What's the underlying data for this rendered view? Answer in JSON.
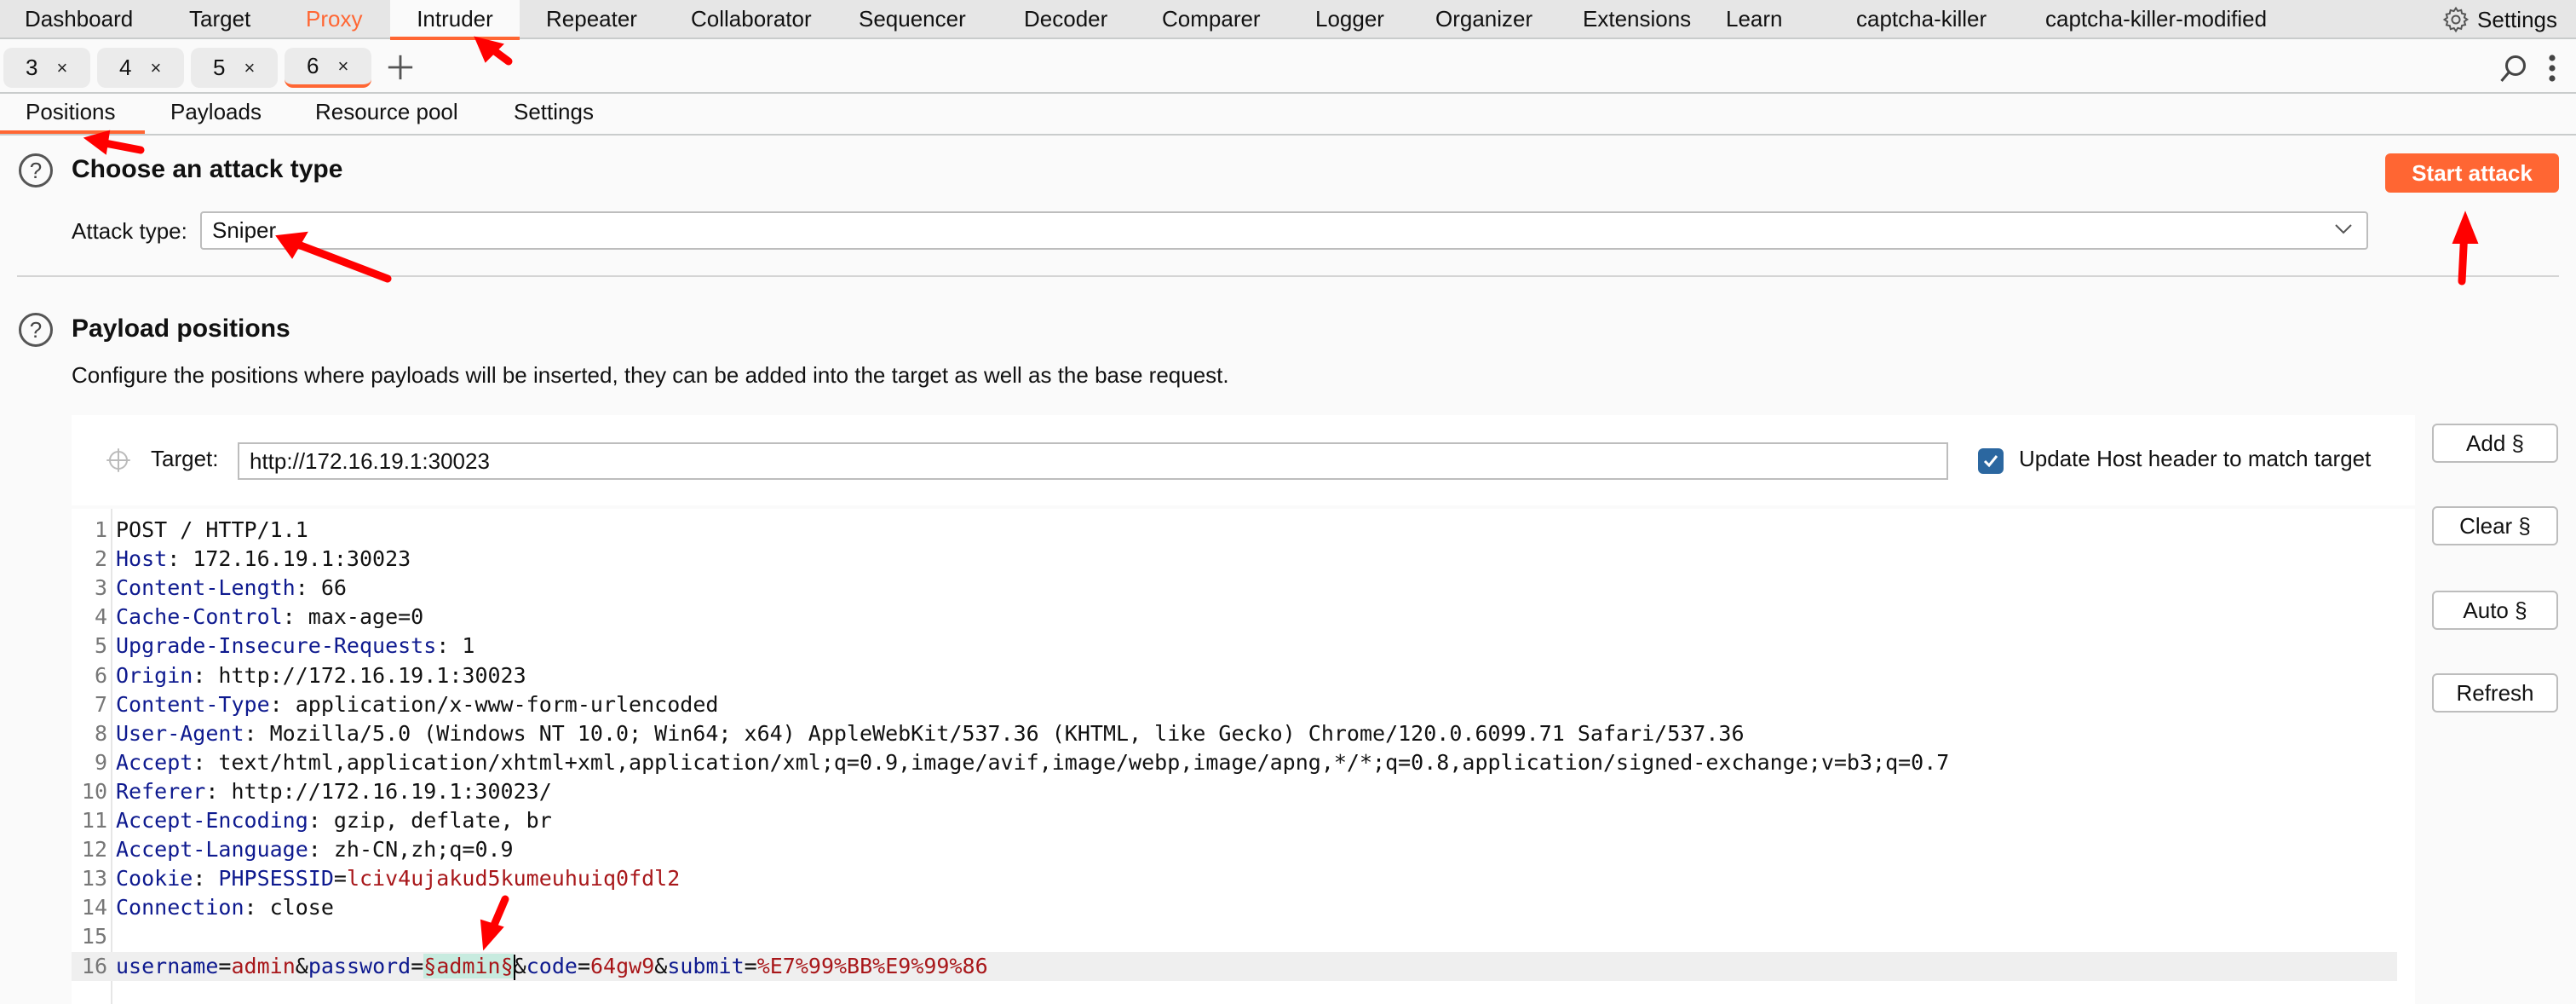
{
  "topnav": {
    "items": [
      {
        "label": "Dashboard"
      },
      {
        "label": "Target"
      },
      {
        "label": "Proxy"
      },
      {
        "label": "Intruder",
        "active": true
      },
      {
        "label": "Repeater"
      },
      {
        "label": "Collaborator"
      },
      {
        "label": "Sequencer"
      },
      {
        "label": "Decoder"
      },
      {
        "label": "Comparer"
      },
      {
        "label": "Logger"
      },
      {
        "label": "Organizer"
      },
      {
        "label": "Extensions"
      },
      {
        "label": "Learn"
      },
      {
        "label": "captcha-killer"
      },
      {
        "label": "captcha-killer-modified"
      }
    ],
    "settings_label": "Settings",
    "accent": "#ff6633"
  },
  "attack_tabs": {
    "tabs": [
      {
        "label": "3",
        "close": "×"
      },
      {
        "label": "4",
        "close": "×"
      },
      {
        "label": "5",
        "close": "×"
      },
      {
        "label": "6",
        "close": "×",
        "active": true
      }
    ],
    "add_icon": "+"
  },
  "subtabs": {
    "items": [
      {
        "label": "Positions",
        "active": true
      },
      {
        "label": "Payloads"
      },
      {
        "label": "Resource pool"
      },
      {
        "label": "Settings"
      }
    ]
  },
  "attack_section": {
    "help_icon": "?",
    "title": "Choose an attack type",
    "attack_type_label": "Attack type:",
    "attack_type_value": "Sniper",
    "start_button": "Start attack"
  },
  "positions_section": {
    "help_icon": "?",
    "title": "Payload positions",
    "description": "Configure the positions where payloads will be inserted, they can be added into the target as well as the base request.",
    "target_label": "Target:",
    "target_value": "http://172.16.19.1:30023",
    "update_host_label": "Update Host header to match target",
    "update_host_checked": true,
    "buttons": {
      "add": "Add §",
      "clear": "Clear §",
      "auto": "Auto §",
      "refresh": "Refresh"
    }
  },
  "request": {
    "lines": [
      {
        "n": "1",
        "segments": [
          {
            "t": "POST / HTTP/1.1",
            "c": "v"
          }
        ]
      },
      {
        "n": "2",
        "segments": [
          {
            "t": "Host",
            "c": "k"
          },
          {
            "t": ": 172.16.19.1:30023",
            "c": "v"
          }
        ]
      },
      {
        "n": "3",
        "segments": [
          {
            "t": "Content-Length",
            "c": "k"
          },
          {
            "t": ": 66",
            "c": "v"
          }
        ]
      },
      {
        "n": "4",
        "segments": [
          {
            "t": "Cache-Control",
            "c": "k"
          },
          {
            "t": ": max-age=0",
            "c": "v"
          }
        ]
      },
      {
        "n": "5",
        "segments": [
          {
            "t": "Upgrade-Insecure-Requests",
            "c": "k"
          },
          {
            "t": ": 1",
            "c": "v"
          }
        ]
      },
      {
        "n": "6",
        "segments": [
          {
            "t": "Origin",
            "c": "k"
          },
          {
            "t": ": http://172.16.19.1:30023",
            "c": "v"
          }
        ]
      },
      {
        "n": "7",
        "segments": [
          {
            "t": "Content-Type",
            "c": "k"
          },
          {
            "t": ": application/x-www-form-urlencoded",
            "c": "v"
          }
        ]
      },
      {
        "n": "8",
        "segments": [
          {
            "t": "User-Agent",
            "c": "k"
          },
          {
            "t": ": Mozilla/5.0 (Windows NT 10.0; Win64; x64) AppleWebKit/537.36 (KHTML, like Gecko) Chrome/120.0.6099.71 Safari/537.36",
            "c": "v"
          }
        ]
      },
      {
        "n": "9",
        "segments": [
          {
            "t": "Accept",
            "c": "k"
          },
          {
            "t": ": text/html,application/xhtml+xml,application/xml;q=0.9,image/avif,image/webp,image/apng,*/*;q=0.8,application/signed-exchange;v=b3;q=0.7",
            "c": "v"
          }
        ]
      },
      {
        "n": "10",
        "segments": [
          {
            "t": "Referer",
            "c": "k"
          },
          {
            "t": ": http://172.16.19.1:30023/",
            "c": "v"
          }
        ]
      },
      {
        "n": "11",
        "segments": [
          {
            "t": "Accept-Encoding",
            "c": "k"
          },
          {
            "t": ": gzip, deflate, br",
            "c": "v"
          }
        ]
      },
      {
        "n": "12",
        "segments": [
          {
            "t": "Accept-Language",
            "c": "k"
          },
          {
            "t": ": zh-CN,zh;q=0.9",
            "c": "v"
          }
        ]
      },
      {
        "n": "13",
        "segments": [
          {
            "t": "Cookie",
            "c": "k"
          },
          {
            "t": ": ",
            "c": "v"
          },
          {
            "t": "PHPSESSID",
            "c": "k"
          },
          {
            "t": "=",
            "c": "v"
          },
          {
            "t": "lciv4ujakud5kumeuhuiq0fdl2",
            "c": "r"
          }
        ]
      },
      {
        "n": "14",
        "segments": [
          {
            "t": "Connection",
            "c": "k"
          },
          {
            "t": ": close",
            "c": "v"
          }
        ]
      },
      {
        "n": "15",
        "segments": []
      },
      {
        "n": "16",
        "current": true,
        "segments": [
          {
            "t": "username",
            "c": "k"
          },
          {
            "t": "=",
            "c": "v"
          },
          {
            "t": "admin",
            "c": "r"
          },
          {
            "t": "&",
            "c": "v"
          },
          {
            "t": "password",
            "c": "k"
          },
          {
            "t": "=",
            "c": "v"
          },
          {
            "t": "§admin§",
            "c": "r marker"
          },
          {
            "caret": true
          },
          {
            "t": "&",
            "c": "v"
          },
          {
            "t": "code",
            "c": "k"
          },
          {
            "t": "=",
            "c": "v"
          },
          {
            "t": "64gw9",
            "c": "r"
          },
          {
            "t": "&",
            "c": "v"
          },
          {
            "t": "submit",
            "c": "k"
          },
          {
            "t": "=",
            "c": "v"
          },
          {
            "t": "%E7%99%BB%E9%99%86",
            "c": "r"
          }
        ]
      }
    ]
  }
}
